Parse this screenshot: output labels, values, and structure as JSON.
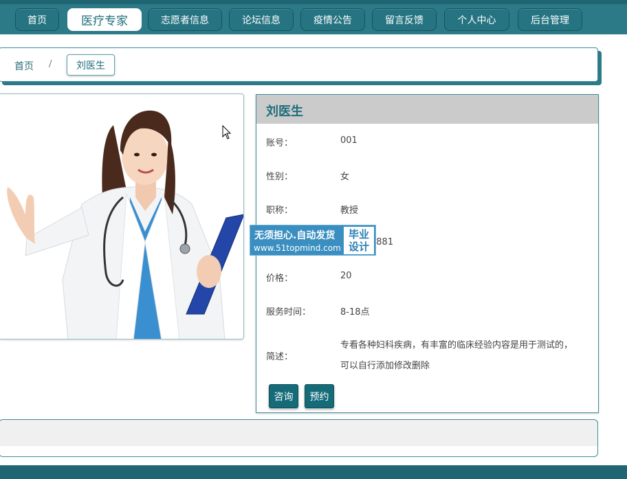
{
  "nav": {
    "items": [
      "首页",
      "医疗专家",
      "志愿者信息",
      "论坛信息",
      "疫情公告",
      "留言反馈",
      "个人中心",
      "后台管理"
    ],
    "active": "医疗专家"
  },
  "breadcrumb": {
    "home": "首页",
    "separator": "/",
    "current": "刘医生"
  },
  "doctor": {
    "name": "刘医生",
    "fields": [
      {
        "label": "账号：",
        "value": "001"
      },
      {
        "label": "性别：",
        "value": "女"
      },
      {
        "label": "职称：",
        "value": "教授"
      },
      {
        "label": "",
        "value": "6881"
      },
      {
        "label": "价格：",
        "value": "20"
      },
      {
        "label": "服务时间：",
        "value": "8-18点"
      }
    ],
    "desc_label": "简述：",
    "desc_value": "专看各种妇科疾病，有丰富的临床经验内容是用于测试的，可以自行添加修改删除"
  },
  "actions": {
    "consult": "咨询",
    "book": "预约"
  },
  "watermark": {
    "line1": "无须担心.自动发货",
    "line2": "www.51topmind.com",
    "badge": "毕业设计"
  },
  "colors": {
    "primary": "#2c7a88",
    "dark": "#1f6572",
    "button": "#156b78",
    "accent_text": "#1f6e7b"
  }
}
